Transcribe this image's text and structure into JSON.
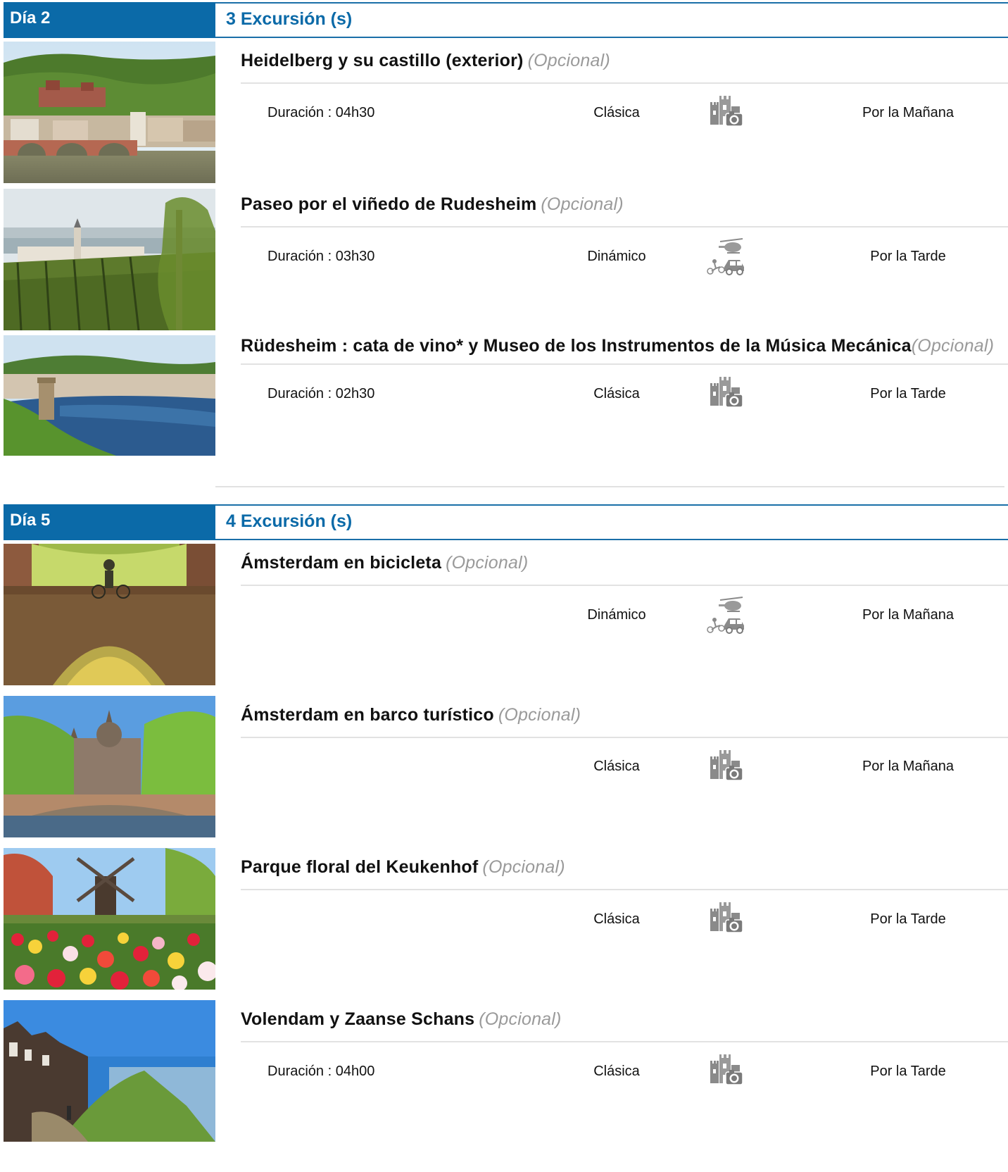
{
  "days": [
    {
      "label": "Día 2",
      "count": "3 Excursión (s)",
      "excursions": [
        {
          "title": "Heidelberg y su castillo (exterior)",
          "optional": "(Opcional)",
          "duration": "Duración : 04h30",
          "type": "Clásica",
          "type_icon": "castle-camera-icon",
          "time": "Por la Mañana",
          "photo": "heidelberg-castle-bridge-photo"
        },
        {
          "title": "Paseo por el viñedo de Rudesheim",
          "optional": "(Opcional)",
          "duration": "Duración : 03h30",
          "type": "Dinámico",
          "type_icon": "helicopter-car-bike-icon",
          "time": "Por la Tarde",
          "photo": "rudesheim-vineyard-photo"
        },
        {
          "title": "Rüdesheim : cata de vino* y Museo de los Instrumentos de la Música Mecánica",
          "optional": "(Opcional)",
          "duration": "Duración : 02h30",
          "type": "Clásica",
          "type_icon": "castle-camera-icon",
          "time": "Por la Tarde",
          "photo": "rhine-river-tower-photo"
        }
      ]
    },
    {
      "label": "Día 5",
      "count": "4 Excursión (s)",
      "excursions": [
        {
          "title": "Ámsterdam en bicicleta",
          "optional": "(Opcional)",
          "duration": "",
          "type": "Dinámico",
          "type_icon": "helicopter-car-bike-icon",
          "time": "Por la Mañana",
          "photo": "amsterdam-bridge-cyclist-photo"
        },
        {
          "title": "Ámsterdam en barco turístico",
          "optional": "(Opcional)",
          "duration": "",
          "type": "Clásica",
          "type_icon": "castle-camera-icon",
          "time": "Por la Mañana",
          "photo": "amsterdam-church-canal-photo"
        },
        {
          "title": "Parque floral del Keukenhof",
          "optional": "(Opcional)",
          "duration": "",
          "type": "Clásica",
          "type_icon": "castle-camera-icon",
          "time": "Por la Tarde",
          "photo": "keukenhof-tulips-windmill-photo"
        },
        {
          "title": "Volendam y Zaanse Schans",
          "optional": "(Opcional)",
          "duration": "Duración : 04h00",
          "type": "Clásica",
          "type_icon": "castle-camera-icon",
          "time": "Por la Tarde",
          "photo": "volendam-waterfront-photo"
        }
      ]
    }
  ]
}
